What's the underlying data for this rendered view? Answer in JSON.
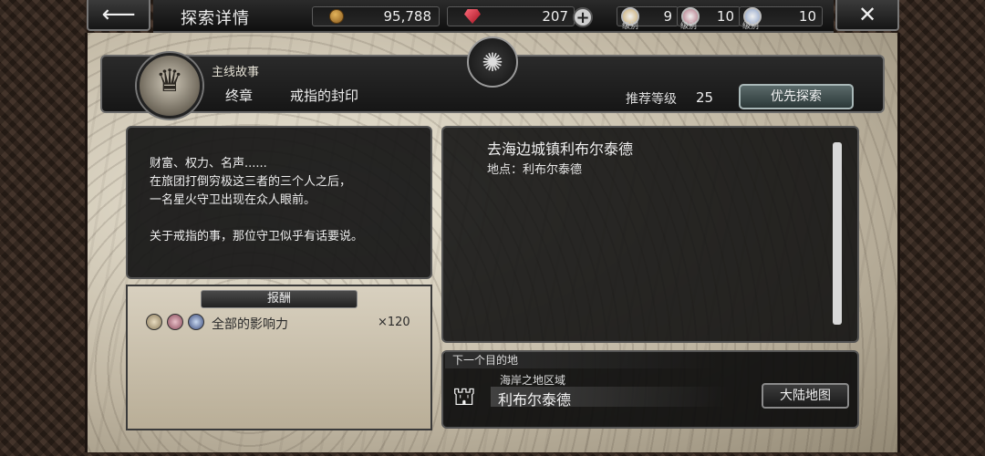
{
  "header": {
    "title": "探索详情",
    "gold": "95,788",
    "gems": "207",
    "badges": [
      {
        "value": "9",
        "label": "级别",
        "color": "#c9a96a"
      },
      {
        "value": "10",
        "label": "级别",
        "color": "#b07080"
      },
      {
        "value": "10",
        "label": "级别",
        "color": "#8aa0c8"
      }
    ]
  },
  "story": {
    "type": "主线故事",
    "chapter": "终章",
    "title": "戒指的封印",
    "recommended_label": "推荐等级",
    "recommended_level": "25",
    "priority_button": "优先探索"
  },
  "description": "财富、权力、名声......\n在旅团打倒穷极这三者的三个人之后，\n一名星火守卫出现在众人眼前。\n\n关于戒指的事，那位守卫似乎有话要说。",
  "reward": {
    "header": "报酬",
    "item_name": "全部的影响力",
    "quantity": "×120"
  },
  "mission": {
    "title": "去海边城镇利布尔泰德",
    "location": "地点：利布尔泰德"
  },
  "next_destination": {
    "header": "下一个目的地",
    "region": "海岸之地区域",
    "name": "利布尔泰德",
    "map_button": "大陆地图"
  }
}
